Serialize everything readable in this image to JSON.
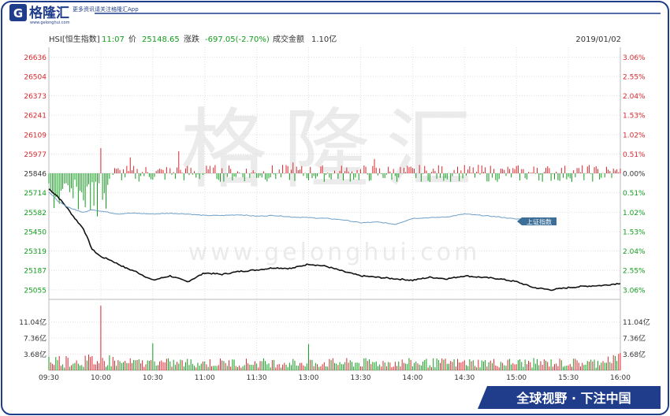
{
  "brand": {
    "logo_text": "格隆汇",
    "tagline": "更多资讯请关注格隆汇App",
    "sub": "www.gelonghui.com",
    "watermark_cn": "格隆汇",
    "watermark_en": "www.gelonghui.com",
    "slogan": "全球视野 · 下注中国",
    "color": "#1f3d8a"
  },
  "header": {
    "symbol": "HSI[恒生指数]",
    "time": "11:07",
    "price_label": "价",
    "price": "25148.65",
    "change_label": "涨跌",
    "change": "-697.05(-2.70%)",
    "turnover_label": "成交金额",
    "turnover": "1.10亿",
    "date": "2019/01/02"
  },
  "legend": {
    "tag": "上证指数"
  },
  "colors": {
    "up": "#d9262c",
    "down": "#119c1c",
    "price_line": "#111111",
    "compare_line": "#6d9fc7",
    "grid": "#e0e0e0",
    "tag_bg": "#3c6e98"
  },
  "chart_data": {
    "type": "line",
    "title": "",
    "prev_close": 25846,
    "ylim": [
      24990,
      26702
    ],
    "y_ticks_left": [
      "26636",
      "26504",
      "26373",
      "26241",
      "26109",
      "25977",
      "25846",
      "25714",
      "25582",
      "25450",
      "25319",
      "25187",
      "25055"
    ],
    "y_ticks_right": [
      "3.06%",
      "2.55%",
      "2.04%",
      "1.53%",
      "1.02%",
      "0.51%",
      "0.00%",
      "0.51%",
      "1.02%",
      "1.53%",
      "2.04%",
      "2.55%",
      "3.06%"
    ],
    "x_ticks": [
      "09:30",
      "10:00",
      "10:30",
      "11:00",
      "11:30",
      "13:00",
      "13:30",
      "14:00",
      "14:30",
      "15:00",
      "15:30",
      "16:00"
    ],
    "series": [
      {
        "name": "HSI",
        "x": [
          0,
          5,
          10,
          15,
          20,
          25,
          30,
          35,
          40,
          45,
          50,
          60,
          70,
          80,
          90,
          100,
          110,
          120,
          130,
          140,
          150,
          160,
          170,
          180,
          190,
          200,
          210,
          220,
          230,
          240,
          250,
          260,
          270,
          280,
          290,
          300,
          310,
          320,
          330
        ],
        "values": [
          25740,
          25690,
          25620,
          25540,
          25470,
          25330,
          25280,
          25260,
          25230,
          25200,
          25180,
          25120,
          25150,
          25110,
          25170,
          25160,
          25180,
          25190,
          25205,
          25200,
          25230,
          25215,
          25180,
          25150,
          25140,
          25130,
          25120,
          25140,
          25130,
          25150,
          25140,
          25130,
          25110,
          25070,
          25055,
          25070,
          25080,
          25085,
          25100
        ]
      },
      {
        "name": "上证指数",
        "x": [
          0,
          5,
          10,
          15,
          20,
          25,
          30,
          35,
          40,
          45,
          50,
          60,
          70,
          80,
          90,
          100,
          110,
          120,
          130,
          140,
          150,
          160,
          170,
          180,
          190,
          200,
          210,
          220,
          230,
          240,
          250,
          260,
          270,
          280
        ],
        "values": [
          25720,
          25660,
          25620,
          25600,
          25580,
          25600,
          25590,
          25580,
          25570,
          25575,
          25575,
          25570,
          25575,
          25570,
          25560,
          25560,
          25565,
          25555,
          25560,
          25550,
          25545,
          25540,
          25530,
          25510,
          25515,
          25500,
          25540,
          25545,
          25550,
          25570,
          25560,
          25550,
          25535,
          25545
        ]
      }
    ],
    "volume": {
      "ylim": [
        0,
        15.5
      ],
      "y_ticks": [
        "11.04亿",
        "7.36亿",
        "3.68亿"
      ],
      "highlights": [
        {
          "x": 30,
          "value": 14.8
        },
        {
          "x": 150,
          "value": 6.0
        },
        {
          "x": 60,
          "value": 6.2
        }
      ]
    }
  }
}
